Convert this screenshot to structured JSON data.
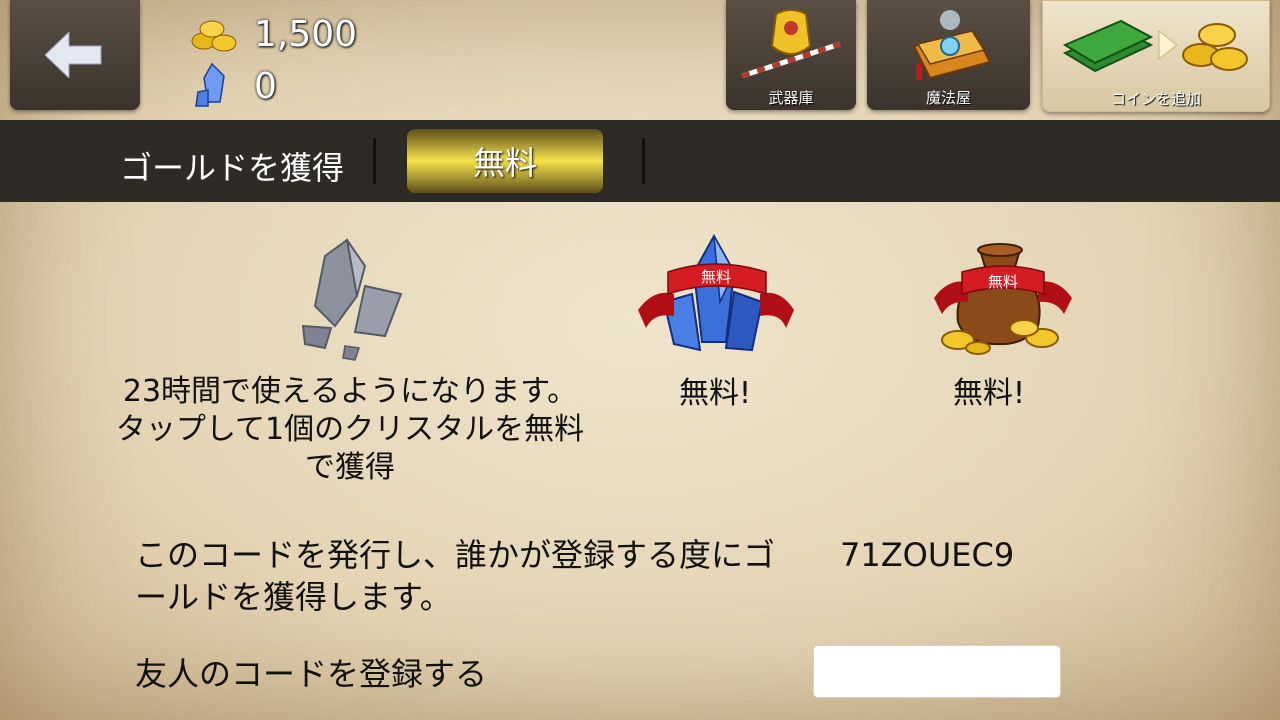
{
  "header": {
    "gold_amount": "1,500",
    "crystal_amount": "0",
    "buttons": [
      {
        "label": "武器庫"
      },
      {
        "label": "魔法屋"
      },
      {
        "label": "コインを追加"
      }
    ]
  },
  "tabs": {
    "title": "ゴールドを獲得",
    "active_tab": "無料"
  },
  "rewards": {
    "crystal_cooldown_line1": "23時間で使えるようになります。",
    "crystal_cooldown_line2": "タップして1個のクリスタルを無料",
    "crystal_cooldown_line3": "で獲得",
    "ribbon_text": "無料",
    "free_crystal_label": "無料!",
    "free_gold_label": "無料!"
  },
  "referral": {
    "issue_text_line1": "このコードを発行し、誰かが登録する度にゴ",
    "issue_text_line2": "ールドを獲得します。",
    "code": "71ZOUEC9",
    "register_label": "友人のコードを登録する",
    "input_value": ""
  },
  "colors": {
    "panel_dark": "#2e2a25",
    "tab_gold": "#f7e14a",
    "ribbon_red": "#c8161d"
  }
}
